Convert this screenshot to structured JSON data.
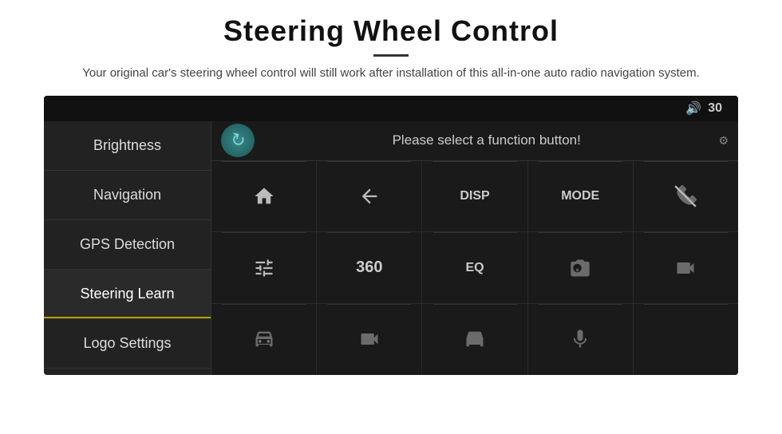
{
  "header": {
    "title": "Steering Wheel Control",
    "description": "Your original car's steering wheel control will still work after installation of this all-in-one auto radio navigation system."
  },
  "topbar": {
    "volume_label": "30"
  },
  "sidebar": {
    "items": [
      {
        "label": "Brightness",
        "active": false
      },
      {
        "label": "Navigation",
        "active": false
      },
      {
        "label": "GPS Detection",
        "active": false
      },
      {
        "label": "Steering Learn",
        "active": true
      },
      {
        "label": "Logo Settings",
        "active": false
      }
    ]
  },
  "function_bar": {
    "prompt": "Please select a function button!"
  },
  "grid": {
    "rows": [
      [
        {
          "type": "icon",
          "icon": "home",
          "label": "Home"
        },
        {
          "type": "icon",
          "icon": "back",
          "label": "Back"
        },
        {
          "type": "text",
          "text": "DISP",
          "label": "Display"
        },
        {
          "type": "text",
          "text": "MODE",
          "label": "Mode"
        },
        {
          "type": "icon",
          "icon": "phone-off",
          "label": "Phone Off"
        }
      ],
      [
        {
          "type": "icon",
          "icon": "tune",
          "label": "Tune"
        },
        {
          "type": "text",
          "text": "360",
          "label": "360"
        },
        {
          "type": "text",
          "text": "EQ",
          "label": "EQ"
        },
        {
          "type": "icon",
          "icon": "camera",
          "label": "Camera"
        },
        {
          "type": "icon",
          "icon": "camera2",
          "label": "Camera2"
        }
      ],
      [
        {
          "type": "icon",
          "icon": "car",
          "label": "Car"
        },
        {
          "type": "icon",
          "icon": "car2",
          "label": "Car2"
        },
        {
          "type": "icon",
          "icon": "car3",
          "label": "Car3"
        },
        {
          "type": "icon",
          "icon": "mic",
          "label": "Mic"
        },
        {
          "type": "empty",
          "label": "Empty"
        }
      ]
    ]
  }
}
